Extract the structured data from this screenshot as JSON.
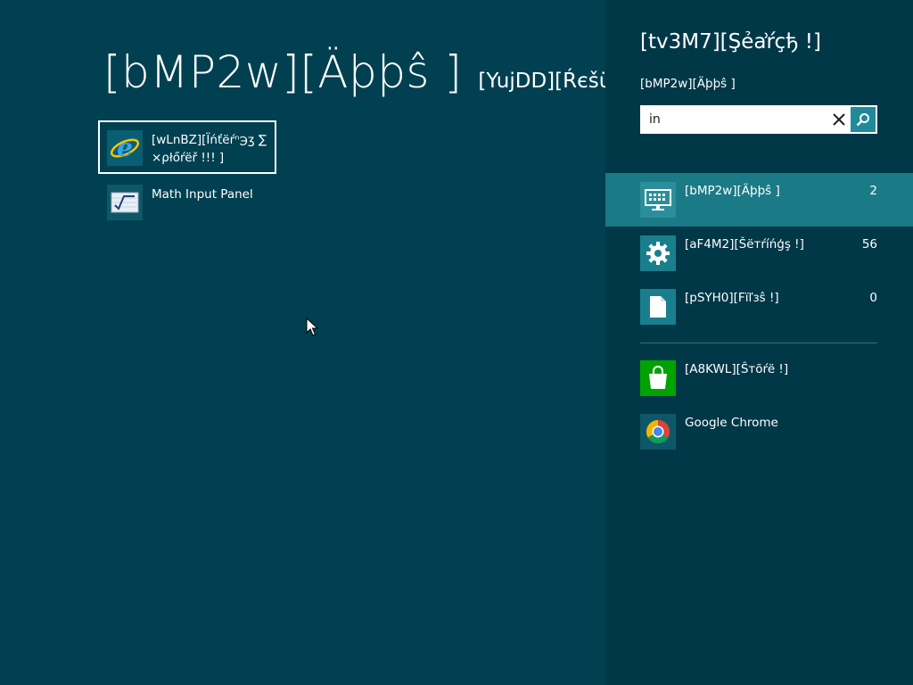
{
  "results": {
    "title": "[bMP2w][Äþþŝ ]",
    "subtitle": "[YujDD][Ŕєšü",
    "apps": [
      {
        "label": "[wLnBZ][Ïńťëŕⁿ℈ʒ ∑×ρłőŕëř !!! ]",
        "icon": "internet-explorer-icon",
        "selected": true
      },
      {
        "label": "Math Input Panel",
        "icon": "math-input-panel-icon",
        "selected": false
      }
    ]
  },
  "search": {
    "title": "[tv3M7][Şẻẚŕçђ !]",
    "scope": "[bMP2w][Äþþŝ ]",
    "query": "in",
    "scopes": [
      {
        "label": "[bMP2w][Äþþŝ ]",
        "count": "2",
        "icon": "apps-icon",
        "active": true
      },
      {
        "label": "[aF4M2][Šëтŕíńģş !]",
        "count": "56",
        "icon": "settings-gear-icon",
        "active": false
      },
      {
        "label": "[pSYH0][Fïľзŝ !]",
        "count": "0",
        "icon": "files-icon",
        "active": false
      }
    ],
    "apps": [
      {
        "label": "[A8KWL][Ŝтõŕë !]",
        "icon": "store-icon"
      },
      {
        "label": "Google Chrome",
        "icon": "chrome-icon"
      }
    ]
  },
  "colors": {
    "background": "#004050",
    "pane": "#003848",
    "active_row": "#1a7a85",
    "store_green": "#00a300"
  }
}
